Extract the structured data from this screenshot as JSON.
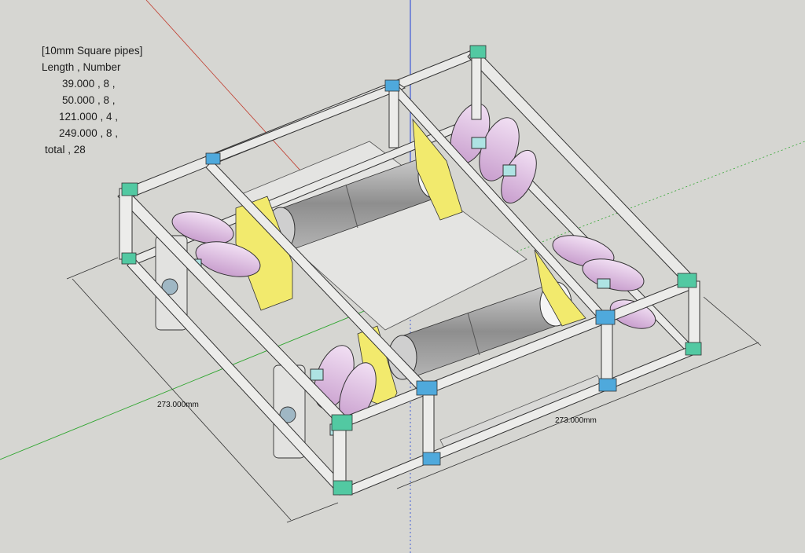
{
  "note": {
    "title": "[10mm Square pipes]",
    "header": "Length , Number",
    "rows": [
      "39.000 , 8 ,",
      "50.000 , 8 ,",
      "121.000 , 4 ,",
      "249.000 , 8 ,"
    ],
    "total": "total , 28"
  },
  "dimensions": {
    "left": "273.000mm",
    "right": "273.000mm"
  },
  "colors": {
    "background": "#d6d6d2",
    "frame": "#e9e9e7",
    "plate": "#d0d0d0",
    "bracket": "#f2ea6d",
    "roller": "#e6c4e8",
    "clamp": "#aee3e3",
    "motor": "#9e9e9e",
    "corner_green": "#52c9a2",
    "corner_blue": "#4fa9dc"
  }
}
